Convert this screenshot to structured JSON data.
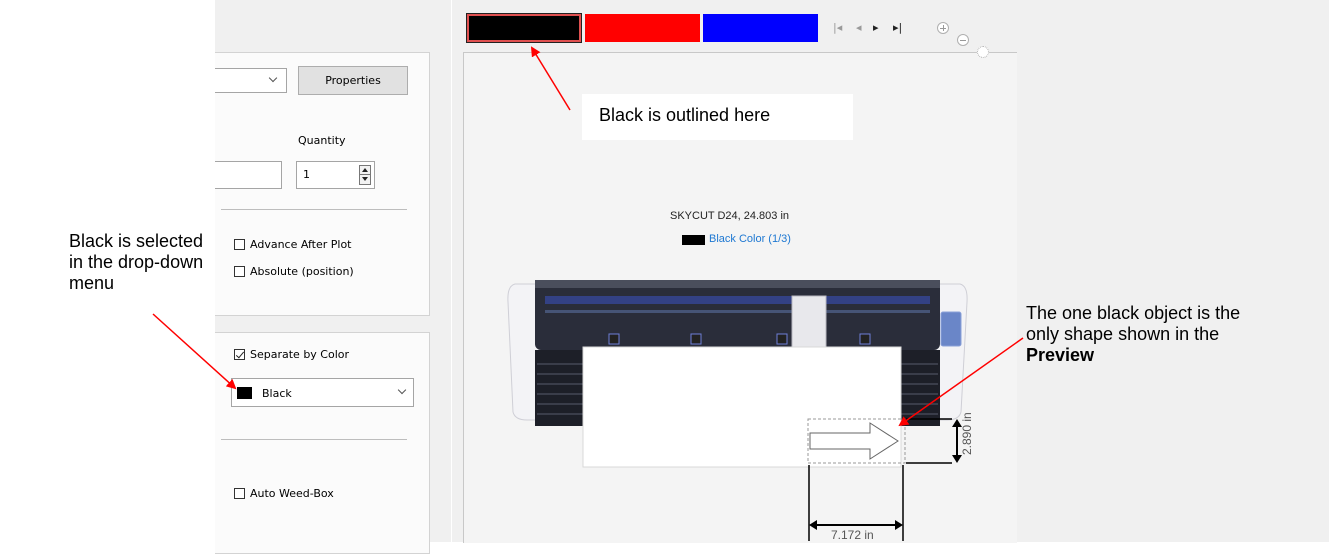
{
  "callouts": {
    "top": "Black is outlined here",
    "left": [
      "Black is selected",
      "in the drop-down",
      "menu"
    ],
    "right_lines": [
      "The one black object is the",
      "only shape shown in the"
    ],
    "right_bold": "Preview"
  },
  "dialog": {
    "properties_button": "Properties",
    "quantity_label": "Quantity",
    "quantity_value": "1",
    "advance_after_plot": "Advance After Plot",
    "absolute_position": "Absolute (position)",
    "separate_by_color": "Separate by Color",
    "color_select_value": "Black",
    "auto_weed_box": "Auto Weed-Box"
  },
  "preview": {
    "swatches": [
      {
        "color": "#000000",
        "selected": true
      },
      {
        "color": "#ff0000",
        "selected": false
      },
      {
        "color": "#0000ff",
        "selected": false
      }
    ],
    "device_label": "SKYCUT D24,  24.803 in",
    "color_label": "Black Color (1/3)",
    "width_dim": "7.172 in",
    "height_dim": "2.890 in"
  },
  "colors": {
    "accent_blue": "#1e78d2",
    "selection_outline": "#e04040"
  }
}
